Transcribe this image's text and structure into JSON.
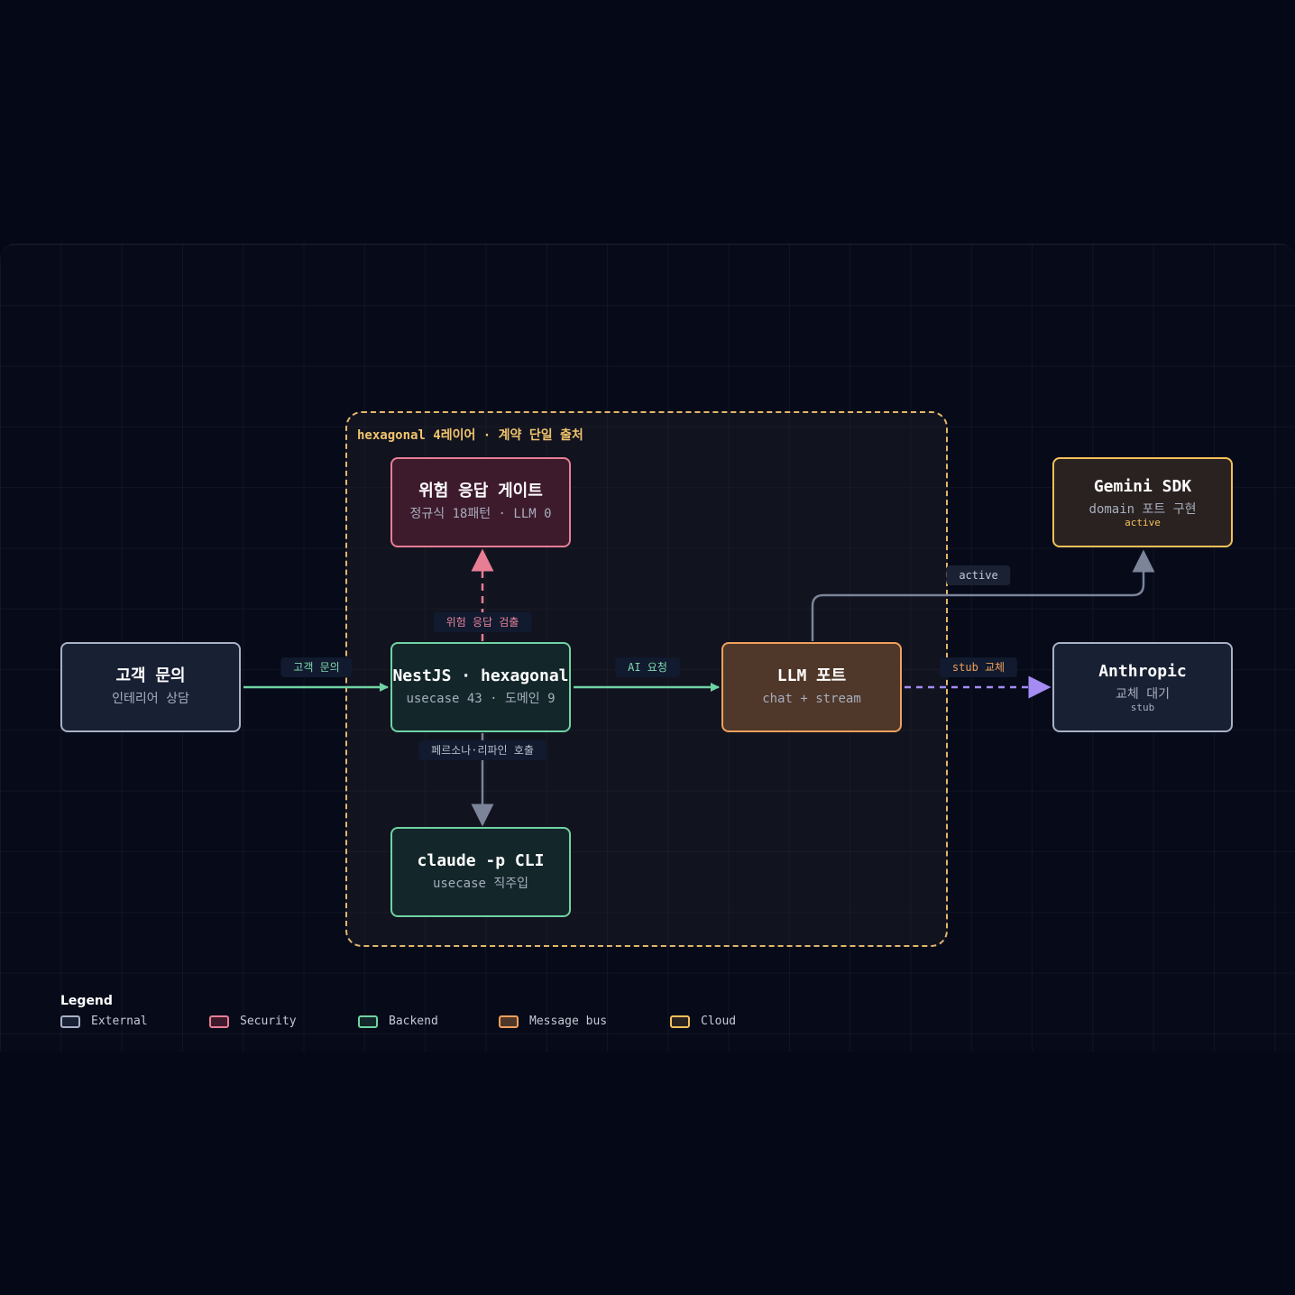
{
  "group": {
    "title": "hexagonal 4레이어 · 계약 단일 출처"
  },
  "nodes": {
    "customer": {
      "title": "고객 문의",
      "subtitle": "인테리어 상담"
    },
    "gate": {
      "title": "위험 응답 게이트",
      "subtitle": "정규식 18패턴 · LLM 0"
    },
    "nest": {
      "title": "NestJS · hexagonal",
      "subtitle": "usecase 43 · 도메인 9"
    },
    "claude": {
      "title": "claude -p CLI",
      "subtitle": "usecase 직주입"
    },
    "llm": {
      "title": "LLM 포트",
      "subtitle": "chat + stream"
    },
    "gemini": {
      "title": "Gemini SDK",
      "subtitle": "domain 포트 구현",
      "badge": "active"
    },
    "anthropic": {
      "title": "Anthropic",
      "subtitle": "교체 대기",
      "badge": "stub"
    }
  },
  "edges": {
    "customer_to_nest": "고객 문의",
    "nest_to_gate": "위험 응답 검출",
    "nest_to_llm": "AI 요청",
    "nest_to_claude": "페르소나·리파인 호출",
    "llm_to_gemini": "active",
    "llm_to_anthropic": "stub 교체"
  },
  "legend": {
    "title": "Legend",
    "items": [
      {
        "label": "External",
        "color": "#a9b1c7"
      },
      {
        "label": "Security",
        "color": "#e77e94"
      },
      {
        "label": "Backend",
        "color": "#6fd3a3"
      },
      {
        "label": "Message bus",
        "color": "#f0a05c"
      },
      {
        "label": "Cloud",
        "color": "#f4c15a"
      }
    ]
  }
}
